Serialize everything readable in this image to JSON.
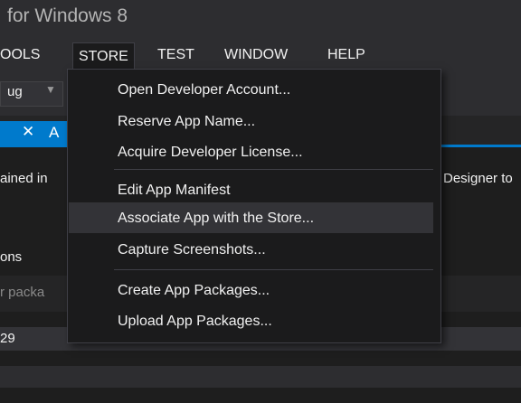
{
  "window": {
    "title": "for Windows 8"
  },
  "menubar": {
    "items": [
      {
        "label": "OOLS"
      },
      {
        "label": "STORE"
      },
      {
        "label": "TEST"
      },
      {
        "label": "WINDOW"
      },
      {
        "label": "HELP"
      }
    ]
  },
  "toolbar": {
    "config_value": "ug"
  },
  "tabs": {
    "active_label": "A",
    "close_glyph": "✕"
  },
  "content": {
    "text_fragment": "ained in",
    "right_fragment": "Designer to",
    "section_label": "ons",
    "package_placeholder": "r packa",
    "row_value": "29"
  },
  "store_menu": {
    "items": [
      {
        "label": "Open Developer Account..."
      },
      {
        "label": "Reserve App Name..."
      },
      {
        "label": "Acquire Developer License..."
      },
      {
        "label": "Edit App Manifest"
      },
      {
        "label": "Associate App with the Store..."
      },
      {
        "label": "Capture Screenshots..."
      },
      {
        "label": "Create App Packages..."
      },
      {
        "label": "Upload App Packages..."
      }
    ]
  },
  "colors": {
    "accent": "#007acc",
    "menu_bg": "#1b1b1c",
    "hover_bg": "#333337"
  }
}
